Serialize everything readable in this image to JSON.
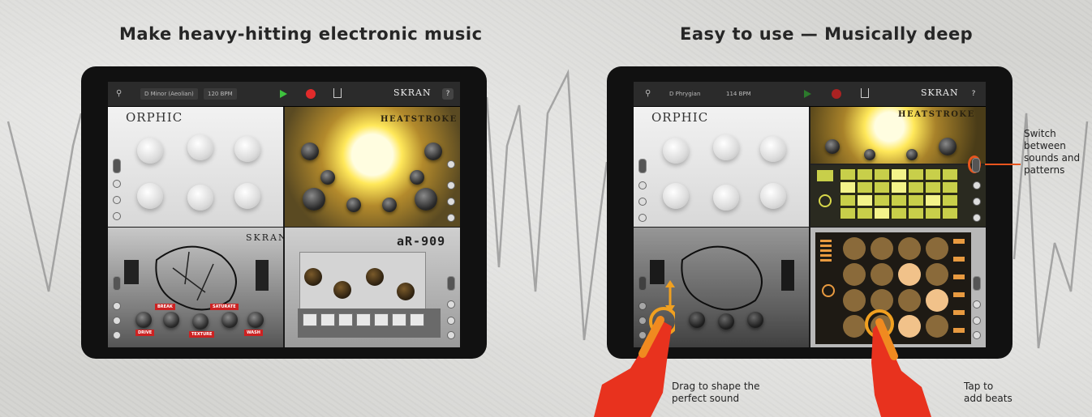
{
  "left_panel": {
    "heading": "Make heavy-hitting electronic music",
    "topbar": {
      "key": "D Minor (Aeolian)",
      "tempo": "120 BPM",
      "logo": "SKRAN",
      "help": "?"
    },
    "modules": {
      "orphic": "ORPHIC",
      "heatstroke": "HEATSTROKE",
      "skran": "SKRAN",
      "ar909": "aR-909"
    },
    "tags": [
      "BREAK",
      "SATURATE",
      "DRIVE",
      "TEXTURE",
      "WASH"
    ]
  },
  "right_panel": {
    "heading": "Easy to use — Musically deep",
    "topbar": {
      "key": "D Phrygian",
      "tempo": "114 BPM",
      "logo": "SKRAN",
      "help": "?"
    },
    "modules": {
      "orphic": "ORPHIC",
      "heatstroke": "HEATSTROKE"
    },
    "callouts": {
      "switch": [
        "Switch",
        "between",
        "sounds and",
        "patterns"
      ],
      "drag": [
        "Drag to shape the",
        "perfect sound"
      ],
      "tap": [
        "Tap to",
        "add beats"
      ]
    }
  },
  "colors": {
    "accent": "#e8551e",
    "play": "#3ec23e",
    "record": "#e12b2b"
  }
}
